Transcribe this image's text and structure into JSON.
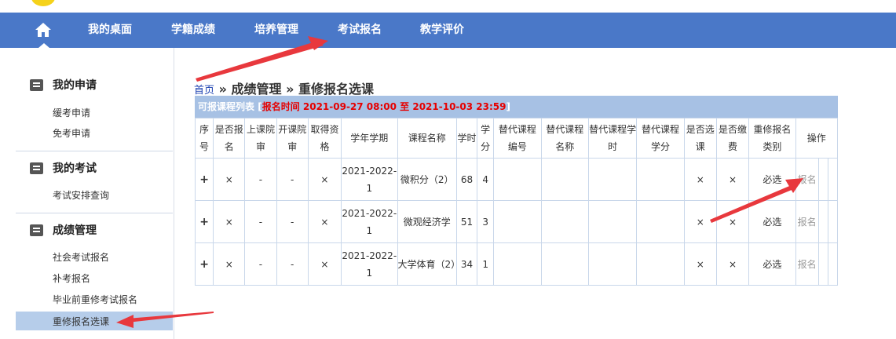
{
  "nav": {
    "items": [
      "我的桌面",
      "学籍成绩",
      "培养管理",
      "考试报名",
      "教学评价"
    ]
  },
  "sidebar": {
    "sections": [
      {
        "title": "我的申请",
        "links": [
          "缓考申请",
          "免考申请"
        ]
      },
      {
        "title": "我的考试",
        "links": [
          "考试安排查询"
        ]
      },
      {
        "title": "成绩管理",
        "links": [
          "社会考试报名",
          "补考报名",
          "毕业前重修考试报名",
          "重修报名选课"
        ]
      }
    ],
    "active": "重修报名选课"
  },
  "breadcrumb": {
    "home": "首页",
    "sep1": " » ",
    "part1": "成绩管理",
    "sep2": " » ",
    "part2": "重修报名选课"
  },
  "table": {
    "title": "可报课程列表",
    "bracket_open": "[",
    "range": "报名时间 2021-09-27 08:00 至 2021-10-03 23:59",
    "bracket_close": "]",
    "headers": [
      "序号",
      "是否报名",
      "上课院审",
      "开课院审",
      "取得资格",
      "学年学期",
      "课程名称",
      "学时",
      "学分",
      "替代课程编号",
      "替代课程名称",
      "替代课程学时",
      "替代课程学分",
      "是否选课",
      "是否缴费",
      "重修报名类别",
      "操作"
    ],
    "rows": [
      [
        "+",
        "×",
        "-",
        "-",
        "×",
        "2021-2022-1",
        "微积分（2）",
        "68",
        "4",
        "",
        "",
        "",
        "",
        "×",
        "×",
        "必选",
        "报名"
      ],
      [
        "+",
        "×",
        "-",
        "-",
        "×",
        "2021-2022-1",
        "微观经济学",
        "51",
        "3",
        "",
        "",
        "",
        "",
        "×",
        "×",
        "必选",
        "报名"
      ],
      [
        "+",
        "×",
        "-",
        "-",
        "×",
        "2021-2022-1",
        "大学体育（2）",
        "34",
        "1",
        "",
        "",
        "",
        "",
        "×",
        "×",
        "必选",
        "报名"
      ]
    ]
  },
  "colors": {
    "nav_bg": "#4a78c8",
    "title_bar": "#a7c1e4",
    "range_red": "#e60000",
    "active_item": "#b6cdea",
    "arrow": "#e8383d"
  },
  "icons": {
    "home": "home-icon",
    "section": "list-icon"
  }
}
